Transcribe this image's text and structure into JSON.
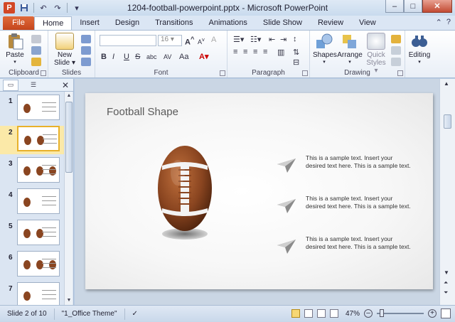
{
  "window": {
    "title": "1204-football-powerpoint.pptx - Microsoft PowerPoint",
    "app_icon_letter": "P",
    "minimize": "–",
    "maximize": "□",
    "close": "✕"
  },
  "quick_access": [
    "save-icon",
    "undo-icon",
    "redo-icon",
    "customize-icon"
  ],
  "tabs": {
    "file": "File",
    "items": [
      "Home",
      "Insert",
      "Design",
      "Transitions",
      "Animations",
      "Slide Show",
      "Review",
      "View"
    ],
    "active": "Home"
  },
  "ribbon": {
    "clipboard": {
      "label": "Clipboard",
      "paste": "Paste"
    },
    "slides": {
      "label": "Slides",
      "new_slide_line1": "New",
      "new_slide_line2": "Slide"
    },
    "font": {
      "label": "Font",
      "font_name": "",
      "font_size": "16",
      "bold": "B",
      "italic": "I",
      "underline": "U",
      "strike": "S",
      "shadow": "abc",
      "spacing": "AV",
      "case": "Aa",
      "grow": "A",
      "shrink": "A",
      "clear": "A"
    },
    "paragraph": {
      "label": "Paragraph"
    },
    "drawing": {
      "label": "Drawing",
      "shapes": "Shapes",
      "arrange": "Arrange",
      "quick_styles_line1": "Quick",
      "quick_styles_line2": "Styles"
    },
    "editing": {
      "label": "Editing"
    }
  },
  "slides_pane": {
    "thumbnails": [
      {
        "num": "1"
      },
      {
        "num": "2"
      },
      {
        "num": "3"
      },
      {
        "num": "4"
      },
      {
        "num": "5"
      },
      {
        "num": "6"
      },
      {
        "num": "7"
      }
    ],
    "active_index": 1
  },
  "slide": {
    "title": "Football Shape",
    "items": [
      "This is a sample text. Insert your desired text here. This is a sample text.",
      "This is a sample text. Insert your desired text here. This is a sample text.",
      "This is a sample text. Insert your desired text here. This is a sample text."
    ]
  },
  "statusbar": {
    "slide_info": "Slide 2 of 10",
    "theme": "\"1_Office Theme\"",
    "zoom": "47%",
    "zoom_minus": "–",
    "zoom_plus": "+"
  },
  "colors": {
    "file_tab": "#c5461c",
    "football": "#8a4520",
    "active_thumb": "#e8b12a"
  }
}
